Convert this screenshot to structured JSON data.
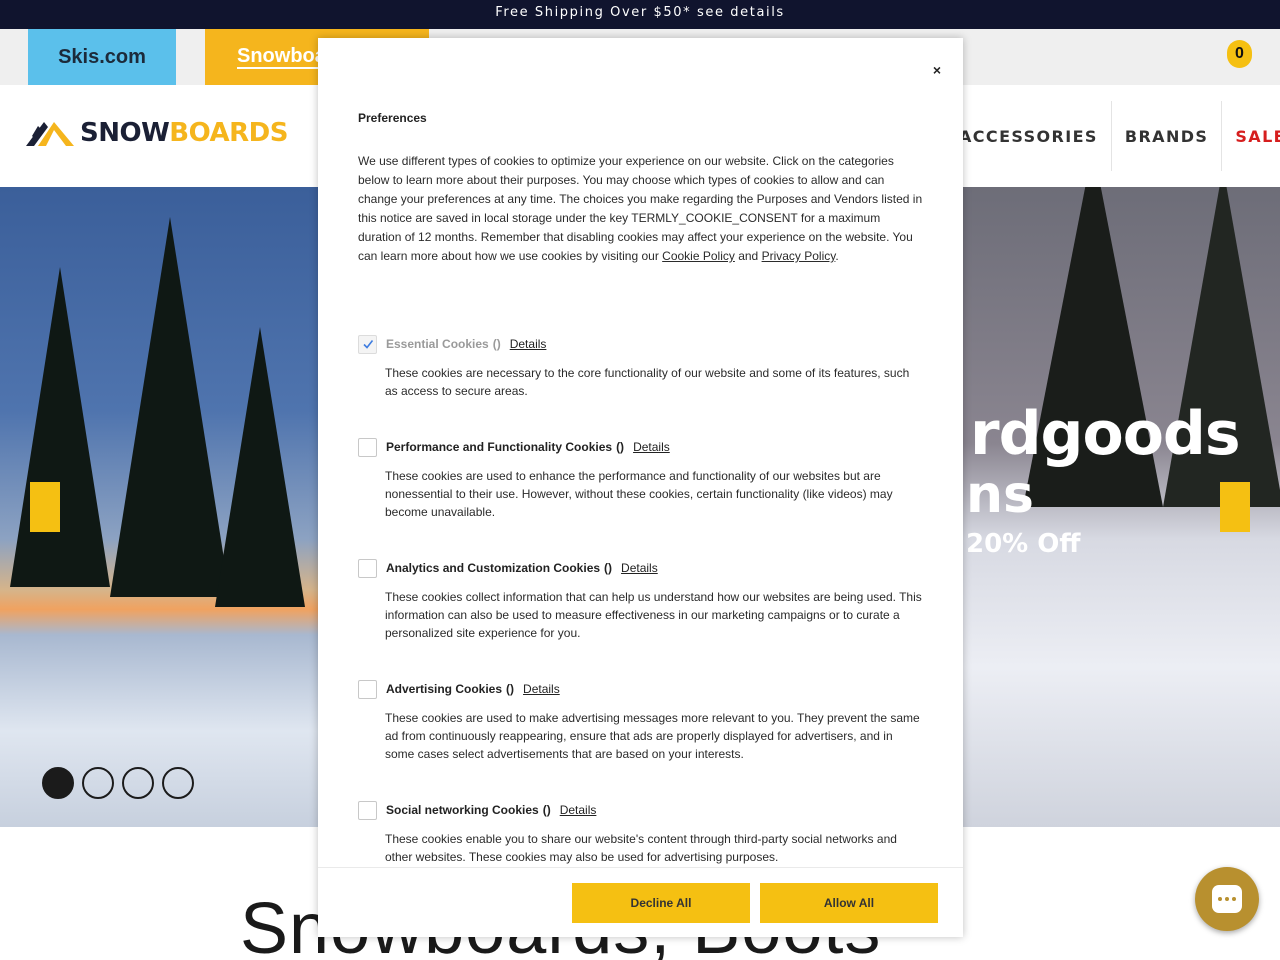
{
  "announcement": "Free Shipping Over $50* see details",
  "site_tabs": {
    "skis": "Skis.com",
    "snowboards": "Snowboards"
  },
  "cart": {
    "count": "0"
  },
  "logo": {
    "part1": "SNOW",
    "part2": "BOARDS"
  },
  "nav": {
    "accessories": "ACCESSORIES",
    "brands": "BRANDS",
    "sale": "SALE"
  },
  "hero": {
    "line1": "rdgoods",
    "line2": "ns",
    "line3": "20% Off"
  },
  "page_heading": "Snowboards, Boots",
  "modal": {
    "close": "×",
    "title": "Preferences",
    "intro_text": "We use different types of cookies to optimize your experience on our website. Click on the categories below to learn more about their purposes. You may choose which types of cookies to allow and can change your preferences at any time. The choices you make regarding the Purposes and Vendors listed in this notice are saved in local storage under the key TERMLY_COOKIE_CONSENT for a maximum duration of 12 months. Remember that disabling cookies may affect your experience on the website. You can learn more about how we use cookies by visiting our ",
    "cookie_policy": "Cookie Policy",
    "and_text": " and ",
    "privacy_policy": "Privacy Policy",
    "period": ".",
    "details_label": "Details",
    "paren": "()",
    "categories": [
      {
        "name": "Essential Cookies",
        "checked": true,
        "description": "These cookies are necessary to the core functionality of our website and some of its features, such as access to secure areas."
      },
      {
        "name": "Performance and Functionality Cookies",
        "checked": false,
        "description": "These cookies are used to enhance the performance and functionality of our websites but are nonessential to their use. However, without these cookies, certain functionality (like videos) may become unavailable."
      },
      {
        "name": "Analytics and Customization Cookies",
        "checked": false,
        "description": "These cookies collect information that can help us understand how our websites are being used. This information can also be used to measure effectiveness in our marketing campaigns or to curate a personalized site experience for you."
      },
      {
        "name": "Advertising Cookies",
        "checked": false,
        "description": "These cookies are used to make advertising messages more relevant to you. They prevent the same ad from continuously reappearing, ensure that ads are properly displayed for advertisers, and in some cases select advertisements that are based on your interests."
      },
      {
        "name": "Social networking Cookies",
        "checked": false,
        "description": "These cookies enable you to share our website's content through third-party social networks and other websites. These cookies may also be used for advertising purposes."
      }
    ],
    "decline_all": "Decline All",
    "allow_all": "Allow All"
  },
  "colors": {
    "accent": "#f5c012",
    "navy": "#10142e",
    "sale": "#d61e1e",
    "skis_tab": "#5bc0eb"
  }
}
